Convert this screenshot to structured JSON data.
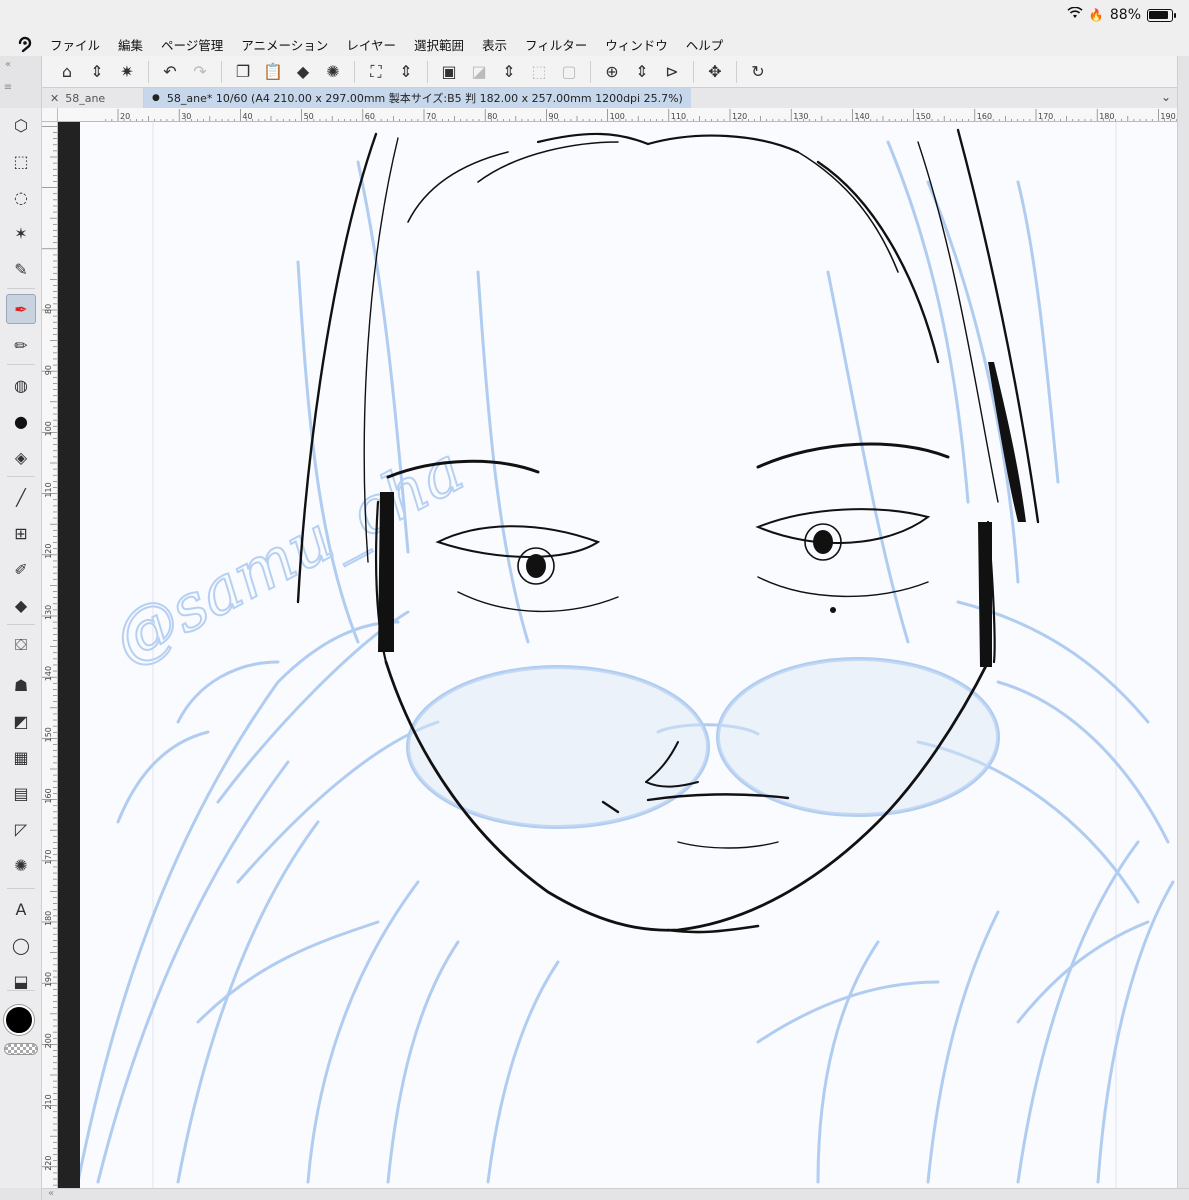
{
  "status_bar": {
    "battery_label": "88%",
    "battery_level": 0.88
  },
  "menu": [
    "ファイル",
    "編集",
    "ページ管理",
    "アニメーション",
    "レイヤー",
    "選択範囲",
    "表示",
    "フィルター",
    "ウィンドウ",
    "ヘルプ"
  ],
  "tabs": {
    "inactive_title": "58_ane",
    "active_title": "58_ane* 10/60 (A4 210.00 x 297.00mm 製本サイズ:B5 判 182.00 x 257.00mm 1200dpi 25.7%)"
  },
  "ruler": {
    "horizontal": [
      "20",
      "30",
      "40",
      "50",
      "60",
      "70",
      "80",
      "90",
      "100",
      "110",
      "120",
      "130",
      "140",
      "150",
      "160",
      "170",
      "180",
      "190"
    ],
    "vertical": [
      "80",
      "90",
      "100",
      "110",
      "120",
      "130",
      "140",
      "150",
      "160",
      "170",
      "180",
      "190",
      "200",
      "210",
      "220"
    ]
  },
  "tools": [
    {
      "name": "operation-tool-icon",
      "glyph": "⬡"
    },
    {
      "name": "rect-select-tool-icon",
      "glyph": "⬚"
    },
    {
      "name": "lasso-tool-icon",
      "glyph": "◌"
    },
    {
      "name": "auto-select-tool-icon",
      "glyph": "✶"
    },
    {
      "name": "eyedropper-tool-icon",
      "glyph": "✎"
    },
    {
      "name": "pen-tool-icon",
      "glyph": "✒"
    },
    {
      "name": "pencil-tool-icon",
      "glyph": "✏"
    },
    {
      "name": "brush-tool-icon",
      "glyph": "◍"
    },
    {
      "name": "airbrush-tool-icon",
      "glyph": "●"
    },
    {
      "name": "decoration-tool-icon",
      "glyph": "◈"
    },
    {
      "name": "line-tool-icon",
      "glyph": "╱"
    },
    {
      "name": "frame-tool-icon",
      "glyph": "⊞"
    },
    {
      "name": "correct-line-tool-icon",
      "glyph": "✐"
    },
    {
      "name": "eraser-tool-icon",
      "glyph": "◆"
    },
    {
      "name": "fill-tool-icon",
      "glyph": "⛋"
    },
    {
      "name": "blend-tool-icon",
      "glyph": "☗"
    },
    {
      "name": "figure-tool-icon",
      "glyph": "◩"
    },
    {
      "name": "tone-tool-icon",
      "glyph": "▦"
    },
    {
      "name": "gradient-tool-icon",
      "glyph": "▤"
    },
    {
      "name": "ruler-tool-icon",
      "glyph": "◸"
    },
    {
      "name": "speed-line-tool-icon",
      "glyph": "✺"
    },
    {
      "name": "text-tool-icon",
      "glyph": "A"
    },
    {
      "name": "balloon-tool-icon",
      "glyph": "◯"
    },
    {
      "name": "layer-move-tool-icon",
      "glyph": "⬓"
    }
  ],
  "commands": [
    {
      "name": "clip-studio-icon",
      "glyph": "⌂"
    },
    {
      "name": "stepper-icon",
      "glyph": "⇕"
    },
    {
      "name": "sparkle-icon",
      "glyph": "✷"
    },
    {
      "name": "sep"
    },
    {
      "name": "undo-icon",
      "glyph": "↶"
    },
    {
      "name": "redo-icon",
      "glyph": "↷",
      "disabled": true
    },
    {
      "name": "sep"
    },
    {
      "name": "copy-icon",
      "glyph": "❐"
    },
    {
      "name": "paste-icon",
      "glyph": "📋"
    },
    {
      "name": "fill-bucket-icon",
      "glyph": "◆"
    },
    {
      "name": "loading-icon",
      "glyph": "✺"
    },
    {
      "name": "sep"
    },
    {
      "name": "transform-icon",
      "glyph": "⛶"
    },
    {
      "name": "stepper-icon",
      "glyph": "⇕"
    },
    {
      "name": "sep"
    },
    {
      "name": "select-layer-icon",
      "glyph": "▣"
    },
    {
      "name": "clear-selection-icon",
      "glyph": "◪",
      "disabled": true
    },
    {
      "name": "stepper-icon",
      "glyph": "⇕"
    },
    {
      "name": "invert-selection-icon",
      "glyph": "⬚",
      "disabled": true
    },
    {
      "name": "selection-border-icon",
      "glyph": "▢",
      "disabled": true
    },
    {
      "name": "sep"
    },
    {
      "name": "zoom-icon",
      "glyph": "⊕"
    },
    {
      "name": "stepper-icon",
      "glyph": "⇕"
    },
    {
      "name": "flip-icon",
      "glyph": "⊳"
    },
    {
      "name": "sep"
    },
    {
      "name": "move-icon",
      "glyph": "✥"
    },
    {
      "name": "sep"
    },
    {
      "name": "rotate-icon",
      "glyph": "↻"
    }
  ],
  "colors": {
    "accent": "#c6d7ec",
    "sketch": "#a9c8f0",
    "ink": "#111111",
    "canvas": "#fafbfe"
  },
  "watermark": "@samu_cha"
}
